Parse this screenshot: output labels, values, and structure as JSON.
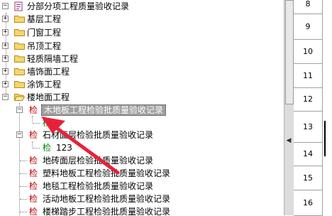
{
  "tree": {
    "items": [
      {
        "label": "分部分项工程质量验收记录",
        "type": "root"
      },
      {
        "label": "基层工程",
        "type": "folder"
      },
      {
        "label": "门窗工程",
        "type": "folder"
      },
      {
        "label": "吊顶工程",
        "type": "folder"
      },
      {
        "label": "轻质隔墙工程",
        "type": "folder"
      },
      {
        "label": "墙饰面工程",
        "type": "folder"
      },
      {
        "label": "涂饰工程",
        "type": "folder"
      },
      {
        "label": "楼地面工程",
        "type": "folder-open"
      },
      {
        "label": "木地板工程检验批质量验收记录",
        "type": "check",
        "selected": true
      },
      {
        "label": "检",
        "type": "sub"
      },
      {
        "label": "石材面层检验批质量验收记录",
        "type": "check"
      },
      {
        "label": "123",
        "type": "sub"
      },
      {
        "label": "地砖面层检验批质量验收记录",
        "type": "check"
      },
      {
        "label": "塑料地板工程检验批质量验收记录",
        "type": "check"
      },
      {
        "label": "地毯工程检验批质量验收记录",
        "type": "check"
      },
      {
        "label": "活动地板工程检验批质量验收记录",
        "type": "check"
      },
      {
        "label": "楼梯踏步工程检验批质量验收记录",
        "type": "check"
      }
    ],
    "check_glyph": "检"
  },
  "grid": {
    "rows": [
      "8",
      "9",
      "10",
      "11",
      "12",
      "13",
      "14",
      "15",
      "16"
    ]
  },
  "colors": {
    "check_red": "#c00000",
    "check_green": "#008000",
    "arrow_red": "#e8203a",
    "folder_yellow": "#f5d66e"
  }
}
